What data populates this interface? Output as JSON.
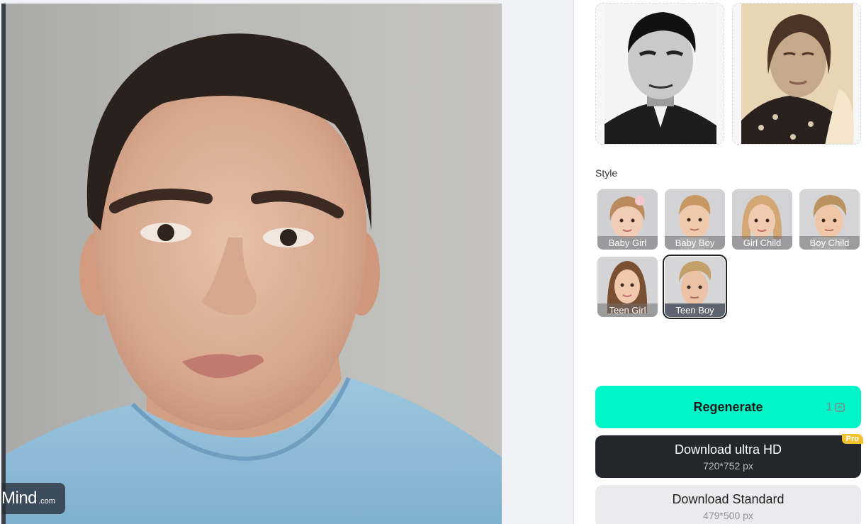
{
  "watermark": {
    "brand": "Mind",
    "suffix": ".com"
  },
  "style_section": {
    "label": "Style"
  },
  "styles": [
    {
      "label": "Baby Girl",
      "selected": false
    },
    {
      "label": "Baby Boy",
      "selected": false
    },
    {
      "label": "Girl Child",
      "selected": false
    },
    {
      "label": "Boy Child",
      "selected": false
    },
    {
      "label": "Teen Girl",
      "selected": false
    },
    {
      "label": "Teen Boy",
      "selected": true
    }
  ],
  "actions": {
    "regenerate": {
      "label": "Regenerate",
      "count": "1"
    },
    "download_hd": {
      "label": "Download ultra HD",
      "size": "720*752 px",
      "badge": "Pro"
    },
    "download_standard": {
      "label": "Download Standard",
      "size": "479*500 px"
    }
  },
  "colors": {
    "accent": "#00f5c8",
    "dark_button": "#23262c",
    "pro_badge": "#f3c232"
  }
}
